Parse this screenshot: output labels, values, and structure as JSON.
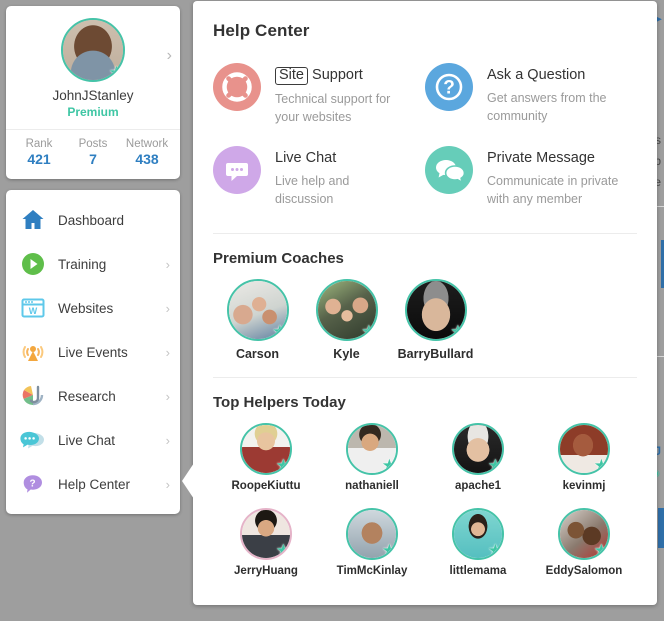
{
  "profile": {
    "username": "JohnJStanley",
    "membership": "Premium",
    "avatar_badge_icon": "star-icon",
    "expand_chevron_icon": "chevron-right-icon",
    "stats": [
      {
        "label": "Rank",
        "value": "421"
      },
      {
        "label": "Posts",
        "value": "7"
      },
      {
        "label": "Network",
        "value": "438"
      }
    ]
  },
  "sidebar": {
    "items": [
      {
        "label": "Dashboard",
        "icon": "home-icon",
        "color": "#2f7fc1",
        "chevron": ""
      },
      {
        "label": "Training",
        "icon": "play-icon",
        "color": "#5fbe4a",
        "chevron": "›"
      },
      {
        "label": "Websites",
        "icon": "browser-w-icon",
        "color": "#5ec8ea",
        "chevron": "›"
      },
      {
        "label": "Live Events",
        "icon": "broadcast-icon",
        "color": "#f3a73f",
        "chevron": "›"
      },
      {
        "label": "Research",
        "icon": "research-icon",
        "color": "#8d9aa6",
        "chevron": "›"
      },
      {
        "label": "Live Chat",
        "icon": "chat-icon",
        "color": "#4ac6d6",
        "chevron": "›"
      },
      {
        "label": "Help Center",
        "icon": "question-bubble-icon",
        "color": "#b08ee0",
        "chevron": "›"
      }
    ]
  },
  "panel": {
    "title": "Help Center",
    "help_items": [
      {
        "label_boxed": "Site",
        "label_rest": "Support",
        "desc": "Technical support for your websites",
        "icon": "lifering-icon",
        "color": "#e8928c"
      },
      {
        "label_boxed": "",
        "label_rest": "Ask a Question",
        "desc": "Get answers from the community",
        "icon": "question-circle-icon",
        "color": "#5ba7de"
      },
      {
        "label_boxed": "",
        "label_rest": "Live Chat",
        "desc": "Live help and discussion",
        "icon": "chat-bubble-icon",
        "color": "#cfa8e8"
      },
      {
        "label_boxed": "",
        "label_rest": "Private Message",
        "desc": "Communicate in private with any member",
        "icon": "double-bubble-icon",
        "color": "#66cdb9"
      }
    ],
    "coaches_title": "Premium Coaches",
    "coaches": [
      {
        "name": "Carson",
        "badge": "star-icon"
      },
      {
        "name": "Kyle",
        "badge": "star-icon"
      },
      {
        "name": "BarryBullard",
        "badge": "star-icon"
      }
    ],
    "helpers_title": "Top Helpers Today",
    "helpers": [
      {
        "name": "RoopeKiuttu",
        "badge": "star-icon"
      },
      {
        "name": "nathaniell",
        "badge": "star-icon"
      },
      {
        "name": "apache1",
        "badge": "star-icon"
      },
      {
        "name": "kevinmj",
        "badge": "star-icon"
      },
      {
        "name": "JerryHuang",
        "badge": "star-icon"
      },
      {
        "name": "TimMcKinlay",
        "badge": "star-icon"
      },
      {
        "name": "littlemama",
        "badge": "star-icon"
      },
      {
        "name": "EddySalomon",
        "badge": "star-icon"
      }
    ]
  },
  "background": {
    "fragments": [
      "s",
      "b",
      "e",
      "J"
    ]
  },
  "colors": {
    "accent_green": "#3fc6a4",
    "link_blue": "#2f7fc1",
    "page_backdrop": "#9e9e9e"
  }
}
